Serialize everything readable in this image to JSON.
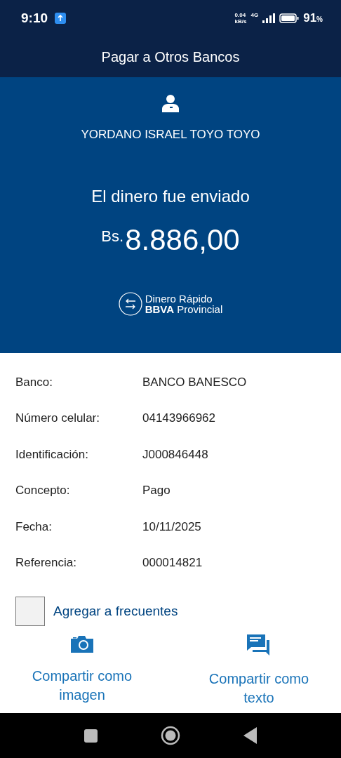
{
  "status_bar": {
    "time": "9:10",
    "net_speed": "0.04",
    "net_unit": "kB/s",
    "network": "4G",
    "battery": "91",
    "battery_unit": "%"
  },
  "header": {
    "title": "Pagar a Otros Bancos"
  },
  "receipt": {
    "beneficiary": "YORDANO ISRAEL TOYO TOYO",
    "message": "El dinero fue enviado",
    "currency": "Bs.",
    "amount": "8.886,00",
    "brand_line_1": "Dinero Rápido",
    "brand_line_2": "**BBVA** Provincial"
  },
  "details": [
    {
      "label": "Banco:",
      "value": "BANCO BANESCO"
    },
    {
      "label": "Número celular:",
      "value": "04143966962"
    },
    {
      "label": "Identificación:",
      "value": "J000846448"
    },
    {
      "label": "Concepto:",
      "value": "Pago"
    },
    {
      "label": "Fecha:",
      "value": "10/11/2025"
    },
    {
      "label": "Referencia:",
      "value": "000014821"
    }
  ],
  "favorite": {
    "label": "Agregar a frecuentes",
    "checked": false
  },
  "share": [
    {
      "kind": "image",
      "label": "Compartir como imagen"
    },
    {
      "kind": "text",
      "label": "Compartir como texto"
    }
  ]
}
